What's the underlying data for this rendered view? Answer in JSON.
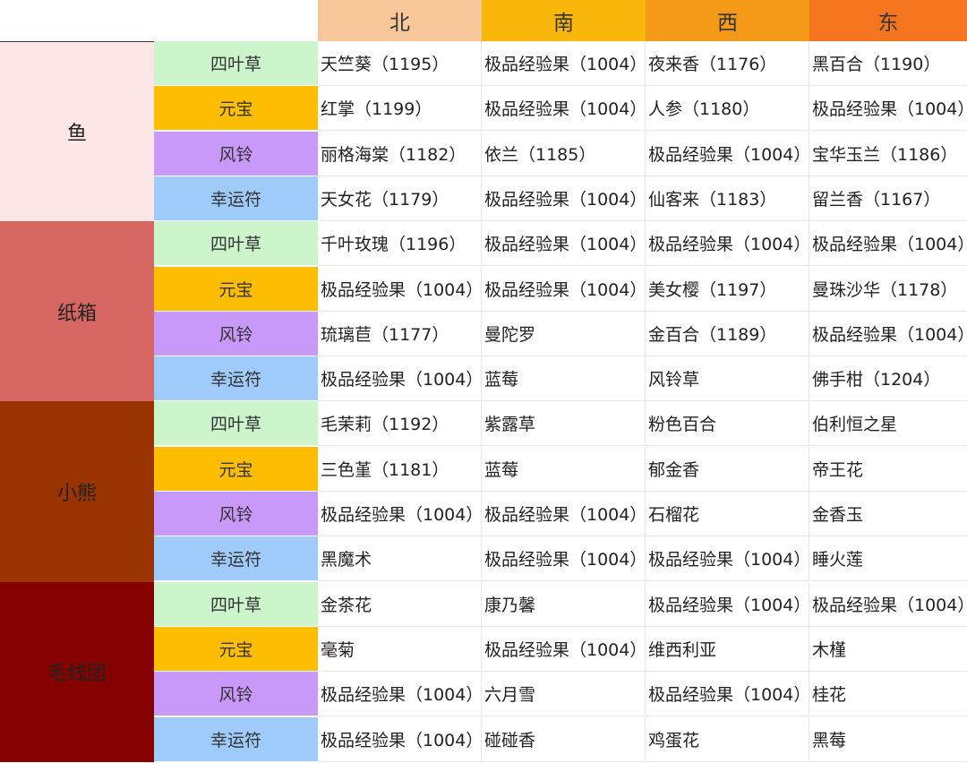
{
  "header": {
    "columns": [
      {
        "label": "北",
        "color": "#f9c89a"
      },
      {
        "label": "南",
        "color": "#f8b70a"
      },
      {
        "label": "西",
        "color": "#f59a18"
      },
      {
        "label": "东",
        "color": "#f4751d"
      }
    ]
  },
  "item_colors": {
    "四叶草": "#ccf5cc",
    "元宝": "#fdbd02",
    "风铃": "#c999fa",
    "幸运符": "#9fcbfb"
  },
  "groups": [
    {
      "name": "鱼",
      "color": "#fde6e6",
      "text_color": "#222222",
      "rows": [
        {
          "item": "四叶草",
          "cells": [
            "天竺葵（1195）",
            "极品经验果（1004）",
            "夜来香（1176）",
            "黑百合（1190）"
          ]
        },
        {
          "item": "元宝",
          "cells": [
            "红掌（1199）",
            "极品经验果（1004）",
            "人参（1180）",
            "极品经验果（1004）"
          ]
        },
        {
          "item": "风铃",
          "cells": [
            "丽格海棠（1182）",
            "依兰（1185）",
            "极品经验果（1004）",
            "宝华玉兰（1186）"
          ]
        },
        {
          "item": "幸运符",
          "cells": [
            "天女花（1179）",
            "极品经验果（1004）",
            "仙客来（1183）",
            "留兰香（1167）"
          ]
        }
      ]
    },
    {
      "name": "纸箱",
      "color": "#d66662",
      "text_color": "#222222",
      "rows": [
        {
          "item": "四叶草",
          "cells": [
            "千叶玫瑰（1196）",
            "极品经验果（1004）",
            "极品经验果（1004）",
            "极品经验果（1004）"
          ]
        },
        {
          "item": "元宝",
          "cells": [
            "极品经验果（1004）",
            "极品经验果（1004）",
            "美女樱（1197）",
            "曼珠沙华（1178）"
          ]
        },
        {
          "item": "风铃",
          "cells": [
            "琉璃苣（1177）",
            "曼陀罗",
            "金百合（1189）",
            "极品经验果（1004）"
          ]
        },
        {
          "item": "幸运符",
          "cells": [
            "极品经验果（1004）",
            "蓝莓",
            "风铃草",
            "佛手柑（1204）"
          ]
        }
      ]
    },
    {
      "name": "小熊",
      "color": "#993300",
      "text_color": "#222222",
      "rows": [
        {
          "item": "四叶草",
          "cells": [
            "毛茉莉（1192）",
            "紫露草",
            "粉色百合",
            "伯利恒之星"
          ]
        },
        {
          "item": "元宝",
          "cells": [
            "三色堇（1181）",
            "蓝莓",
            "郁金香",
            "帝王花"
          ]
        },
        {
          "item": "风铃",
          "cells": [
            "极品经验果（1004）",
            "极品经验果（1004）",
            "石榴花",
            "金香玉"
          ]
        },
        {
          "item": "幸运符",
          "cells": [
            "黑魔术",
            "极品经验果（1004）",
            "极品经验果（1004）",
            "睡火莲"
          ]
        }
      ]
    },
    {
      "name": "毛线团",
      "color": "#850100",
      "text_color": "#222222",
      "rows": [
        {
          "item": "四叶草",
          "cells": [
            "金茶花",
            "康乃馨",
            "极品经验果（1004）",
            "极品经验果（1004）"
          ]
        },
        {
          "item": "元宝",
          "cells": [
            "毫菊",
            "极品经验果（1004）",
            "维西利亚",
            "木槿"
          ]
        },
        {
          "item": "风铃",
          "cells": [
            "极品经验果（1004）",
            "六月雪",
            "极品经验果（1004）",
            "桂花"
          ]
        },
        {
          "item": "幸运符",
          "cells": [
            "极品经验果（1004）",
            "碰碰香",
            "鸡蛋花",
            "黑莓"
          ]
        }
      ]
    }
  ]
}
